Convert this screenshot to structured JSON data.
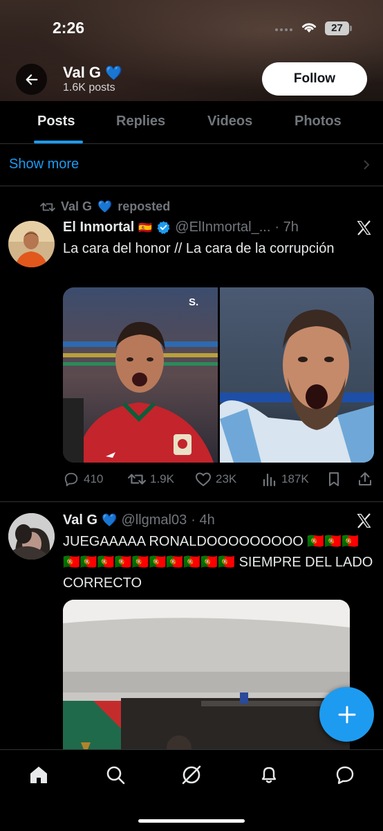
{
  "status_bar": {
    "time": "2:26",
    "battery": "27"
  },
  "profile": {
    "name": "Val G",
    "verified_emoji": "💙",
    "posts_count": "1.6K posts",
    "follow_label": "Follow"
  },
  "tabs": [
    {
      "label": "Posts",
      "active": true
    },
    {
      "label": "Replies",
      "active": false
    },
    {
      "label": "Videos",
      "active": false
    },
    {
      "label": "Photos",
      "active": false
    }
  ],
  "show_more": "Show more",
  "posts": [
    {
      "repost_by": "Val G",
      "repost_emoji": "💙",
      "repost_label": "reposted",
      "author": "El Inmortal",
      "author_flag": "🇪🇸",
      "handle": "@ElInmortal_...",
      "time": "· 7h",
      "text": "La cara del honor   //  La cara de la corrupción",
      "stats": {
        "replies": "410",
        "reposts": "1.9K",
        "likes": "23K",
        "views": "187K"
      }
    },
    {
      "author": "Val G",
      "author_emoji": "💙",
      "handle": "@llgmal03",
      "time": "· 4h",
      "text": "JUEGAAAAA RONALDOOOOOOOOO 🇵🇹🇵🇹🇵🇹🇵🇹🇵🇹🇵🇹🇵🇹🇵🇹🇵🇹🇵🇹🇵🇹🇵🇹🇵🇹 SIEMPRE DEL LADO CORRECTO"
    }
  ],
  "colors": {
    "accent": "#1d9bf0",
    "background": "#000000",
    "muted": "#71767b",
    "text": "#e7e9ea"
  },
  "icons": [
    "back-arrow-icon",
    "verified-heart-icon",
    "repost-icon",
    "x-logo-icon",
    "reply-icon",
    "like-icon",
    "views-icon",
    "bookmark-icon",
    "share-icon",
    "compose-plus-icon",
    "home-icon",
    "search-icon",
    "grok-icon",
    "notifications-icon",
    "messages-icon"
  ]
}
